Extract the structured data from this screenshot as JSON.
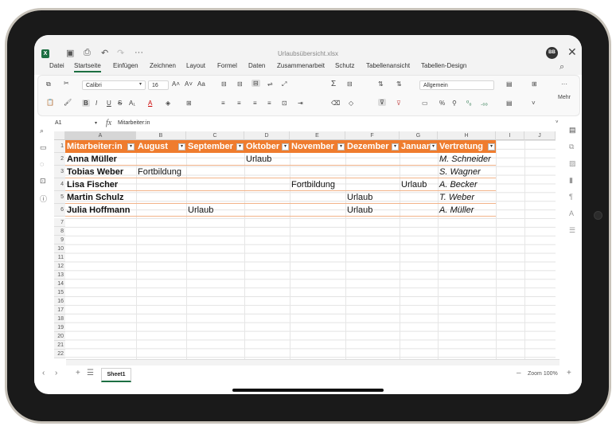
{
  "window": {
    "filename": "Urlaubsübersicht.xlsx",
    "avatar": "BB",
    "app_icon": "X"
  },
  "menu": [
    "Datei",
    "Startseite",
    "Einfügen",
    "Zeichnen",
    "Layout",
    "Formel",
    "Daten",
    "Zusammenarbeit",
    "Schutz",
    "Tabellenansicht",
    "Tabellen-Design"
  ],
  "ribbon": {
    "font": "Calibri",
    "size": "16",
    "number_format": "Allgemein",
    "more": "Mehr"
  },
  "formula_bar": {
    "cell_ref": "A1",
    "fx": "fx",
    "value": "Mitarbeiter:in"
  },
  "columns": [
    "A",
    "B",
    "C",
    "D",
    "E",
    "F",
    "G",
    "H",
    "I",
    "J"
  ],
  "rows": [
    "1",
    "2",
    "3",
    "4",
    "5",
    "6",
    "7",
    "8",
    "9",
    "10",
    "11",
    "12",
    "13",
    "14",
    "15",
    "16",
    "17",
    "18",
    "19",
    "20",
    "21",
    "22"
  ],
  "table": {
    "headers": [
      "Mitarbeiter:in",
      "August",
      "September",
      "Oktober",
      "November",
      "Dezember",
      "Januar",
      "Vertretung"
    ],
    "data": [
      [
        "Anna Müller",
        "",
        "",
        "Urlaub",
        "",
        "",
        "",
        "M. Schneider"
      ],
      [
        "Tobias Weber",
        "Fortbildung",
        "",
        "",
        "",
        "",
        "",
        "S. Wagner"
      ],
      [
        "Lisa Fischer",
        "",
        "",
        "",
        "Fortbildung",
        "",
        "Urlaub",
        "A. Becker"
      ],
      [
        "Martin Schulz",
        "",
        "",
        "",
        "",
        "Urlaub",
        "",
        "T. Weber"
      ],
      [
        "Julia Hoffmann",
        "",
        "Urlaub",
        "",
        "",
        "Urlaub",
        "",
        "A. Müller"
      ]
    ]
  },
  "sheet": {
    "tab": "Sheet1",
    "zoom": "Zoom 100%"
  },
  "colors": {
    "header": "#ef7c2e",
    "accent": "#1d6f42"
  }
}
